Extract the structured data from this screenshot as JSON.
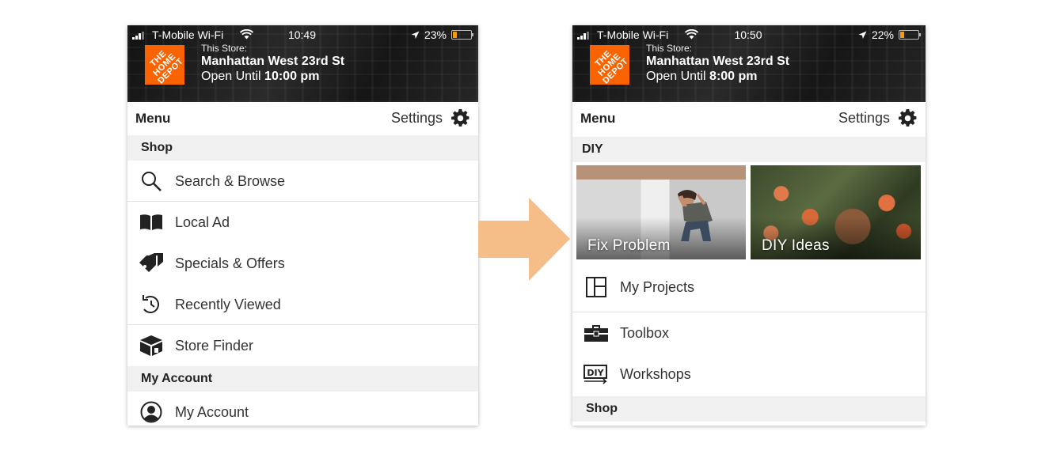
{
  "colors": {
    "brand_orange": "#F96302",
    "arrow": "#F5BE89",
    "section_bg": "#F0F0F0",
    "battery": "#F39C12"
  },
  "left": {
    "status": {
      "carrier": "T-Mobile Wi-Fi",
      "time": "10:49",
      "battery": "23%",
      "battery_level": 0.23
    },
    "logo_text": "THE HOME DEPOT",
    "store": {
      "label": "This Store:",
      "name": "Manhattan West 23rd St",
      "hours_prefix": "Open Until",
      "hours_time": "10:00 pm"
    },
    "menu_title": "Menu",
    "settings_label": "Settings",
    "sections": [
      {
        "title": "Shop"
      },
      {
        "title": "My Account"
      }
    ],
    "items": [
      {
        "label": "Search & Browse",
        "icon": "search-icon"
      },
      {
        "label": "Local Ad",
        "icon": "book-icon"
      },
      {
        "label": "Specials & Offers",
        "icon": "tag-icon"
      },
      {
        "label": "Recently Viewed",
        "icon": "history-icon"
      },
      {
        "label": "Store Finder",
        "icon": "store-icon"
      },
      {
        "label": "My Account",
        "icon": "user-icon"
      }
    ]
  },
  "right": {
    "status": {
      "carrier": "T-Mobile Wi-Fi",
      "time": "10:50",
      "battery": "22%",
      "battery_level": 0.22
    },
    "logo_text": "THE HOME DEPOT",
    "store": {
      "label": "This Store:",
      "name": "Manhattan West 23rd St",
      "hours_prefix": "Open Until",
      "hours_time": "8:00 pm"
    },
    "menu_title": "Menu",
    "settings_label": "Settings",
    "sections": [
      {
        "title": "DIY"
      },
      {
        "title": "Shop"
      }
    ],
    "tiles": [
      {
        "label": "Fix Problem"
      },
      {
        "label": "DIY Ideas"
      }
    ],
    "items": [
      {
        "label": "My Projects",
        "icon": "layout-icon"
      },
      {
        "label": "Toolbox",
        "icon": "toolbox-icon"
      },
      {
        "label": "Workshops",
        "icon": "diy-workshop-icon"
      }
    ]
  }
}
